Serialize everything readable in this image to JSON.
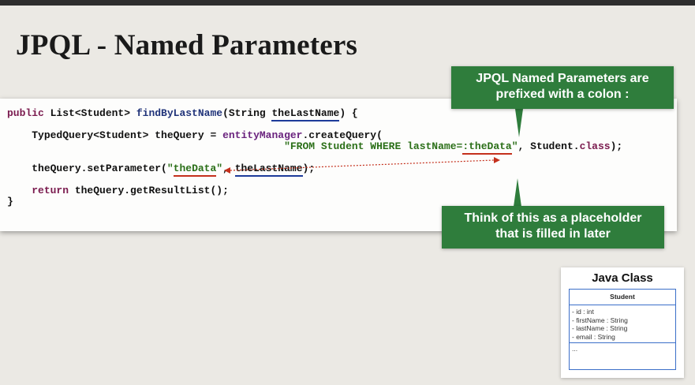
{
  "slide": {
    "title": "JPQL - Named Parameters"
  },
  "code": {
    "line1": {
      "kw_public": "public",
      "type_list": " List<Student> ",
      "method_name": "findByLastName",
      "paren_open": "(String ",
      "param": "theLastName",
      "tail": ") {"
    },
    "line2": {
      "indent": "    ",
      "typed": "TypedQuery<Student> theQuery = ",
      "em": "entityManager",
      "create": ".createQuery("
    },
    "line3": {
      "indent": "                                             ",
      "str_part": "\"FROM Student WHERE lastName=",
      "param_ref": ":theData",
      "str_close": "\"",
      "after": ", Student.",
      "kw_class": "class",
      "end": ");"
    },
    "line4": {
      "indent": "    ",
      "set_call": "theQuery.setParameter(",
      "q1": "\"",
      "param_name": "theData",
      "q2": "\"",
      "comma": ", ",
      "value": "theLastName",
      "end": ");"
    },
    "line5": {
      "indent": "    ",
      "kw_return": "return",
      "rest": " theQuery.getResultList();"
    },
    "line6": "}"
  },
  "callouts": {
    "top": {
      "line1": "JPQL Named Parameters are",
      "line2": "prefixed with a colon :"
    },
    "bottom": {
      "line1": "Think of this as a placeholder",
      "line2": "that is filled in later"
    }
  },
  "java_class": {
    "title": "Java Class",
    "class_name": "Student",
    "fields": [
      "- id : int",
      "- firstName : String",
      "- lastName : String",
      "- email : String"
    ],
    "methods": "..."
  },
  "colors": {
    "callout_green": "#2f7d3c",
    "keyword": "#7a1a4e",
    "method": "#21347a",
    "string": "#2b6f18",
    "underline_blue": "#1d3b9a",
    "underline_red": "#c4301c"
  }
}
